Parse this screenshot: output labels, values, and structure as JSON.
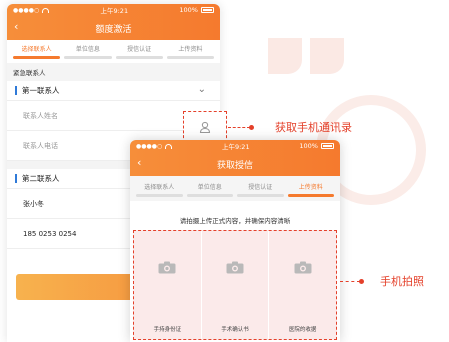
{
  "colors": {
    "accent": "#f57a2e",
    "callout": "#e4402a",
    "tab_mark": "#2f7ad8"
  },
  "phone1": {
    "status": {
      "time": "上午9:21",
      "battery": "100%"
    },
    "title": "额度激活",
    "back_icon": "chevron-left-icon",
    "steps": [
      {
        "label": "选择联系人",
        "active": true
      },
      {
        "label": "单位信息",
        "active": false
      },
      {
        "label": "授信认证",
        "active": false
      },
      {
        "label": "上传资料",
        "active": false
      }
    ],
    "section_title": "紧急联系人",
    "contact1": {
      "title": "第一联系人",
      "name_placeholder": "联系人姓名",
      "phone_placeholder": "联系人电话"
    },
    "contact2": {
      "title": "第二联系人",
      "name_value": "张小冬",
      "phone_value": "185 0253 0254"
    },
    "next_label": "下一步"
  },
  "callouts": {
    "contacts": "获取手机通讯录",
    "photo": "手机拍照"
  },
  "phone2": {
    "status": {
      "time": "上午9:21",
      "battery": "100%"
    },
    "title": "获取授信",
    "steps": [
      {
        "label": "选择联系人",
        "active": false
      },
      {
        "label": "单位信息",
        "active": false
      },
      {
        "label": "授信认证",
        "active": false
      },
      {
        "label": "上传资料",
        "active": true
      }
    ],
    "notice": "请拍摄上传正式内容，并确保内容清晰",
    "photos": [
      {
        "caption": "手持身份证",
        "icon": "camera-icon"
      },
      {
        "caption": "手术确认书",
        "icon": "camera-icon"
      },
      {
        "caption": "医院的收据",
        "icon": "camera-icon"
      }
    ]
  }
}
